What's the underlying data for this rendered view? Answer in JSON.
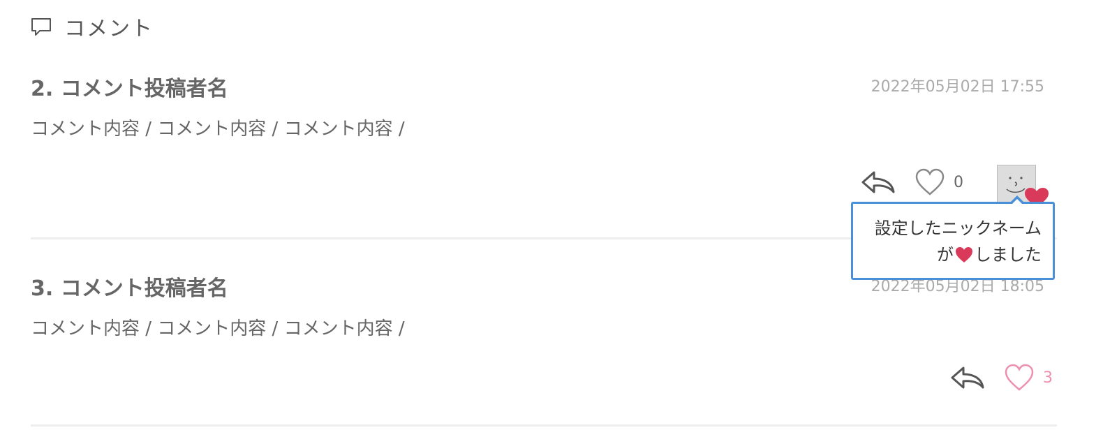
{
  "section": {
    "title": "コメント",
    "icon": "comment-icon"
  },
  "comments": [
    {
      "author": "2. コメント投稿者名",
      "date": "2022年05月02日 17:55",
      "body": "コメント内容 / コメント内容 / コメント内容 /",
      "like_count": "0",
      "liked": false
    },
    {
      "author": "3. コメント投稿者名",
      "date": "2022年05月02日 18:05",
      "body": "コメント内容 / コメント内容 / コメント内容 /",
      "like_count": "3",
      "liked": true
    }
  ],
  "tooltip": {
    "line1": "設定したニックネーム",
    "line2_prefix": "が",
    "line2_suffix": "しました"
  },
  "colors": {
    "heart_red": "#d93a5a",
    "heart_pink": "#ee8fb1",
    "tooltip_border": "#4a90d9"
  }
}
